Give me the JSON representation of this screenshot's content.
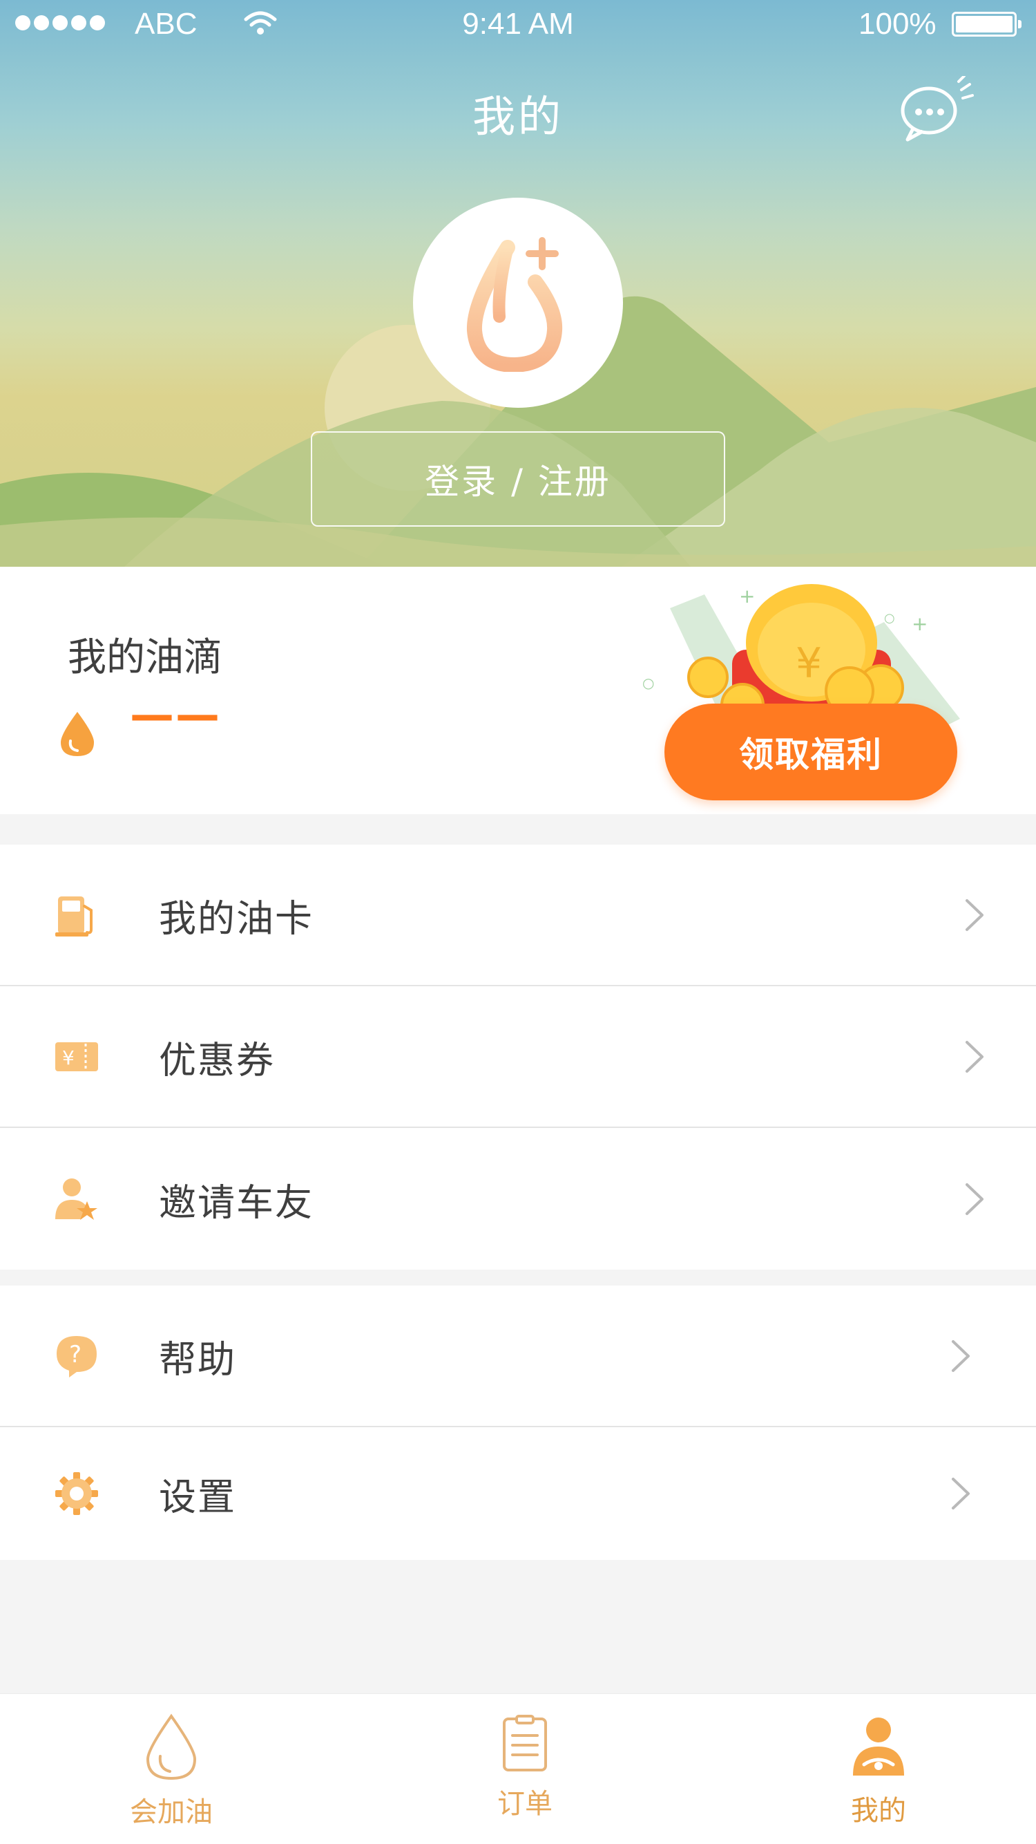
{
  "status_bar": {
    "carrier": "ABC",
    "time": "9:41 AM",
    "battery": "100%"
  },
  "header": {
    "title": "我的",
    "message_icon": "message-bubble-icon"
  },
  "profile": {
    "avatar_icon": "oil-drop-plus-logo-icon",
    "login_label": "登录 / 注册"
  },
  "oil_card": {
    "label": "我的油滴",
    "value": "——",
    "benefit_button": "领取福利",
    "gift_icon": "red-envelope-coins-icon"
  },
  "menu": [
    {
      "icon": "fuel-pump-icon",
      "label": "我的油卡"
    },
    {
      "icon": "coupon-yen-icon",
      "label": "优惠券"
    },
    {
      "icon": "invite-user-star-icon",
      "label": "邀请车友"
    }
  ],
  "menu2": [
    {
      "icon": "help-question-icon",
      "label": "帮助"
    },
    {
      "icon": "settings-gear-icon",
      "label": "设置"
    }
  ],
  "tabs": [
    {
      "label": "会加油",
      "icon": "oil-drop-outline-icon",
      "active": false
    },
    {
      "label": "订单",
      "icon": "order-clipboard-icon",
      "active": false
    },
    {
      "label": "我的",
      "icon": "user-person-icon",
      "active": true
    }
  ],
  "colors": {
    "accent": "#ff7a21",
    "icon_orange": "#f6a84a",
    "tab_label": "#e6a85c"
  }
}
